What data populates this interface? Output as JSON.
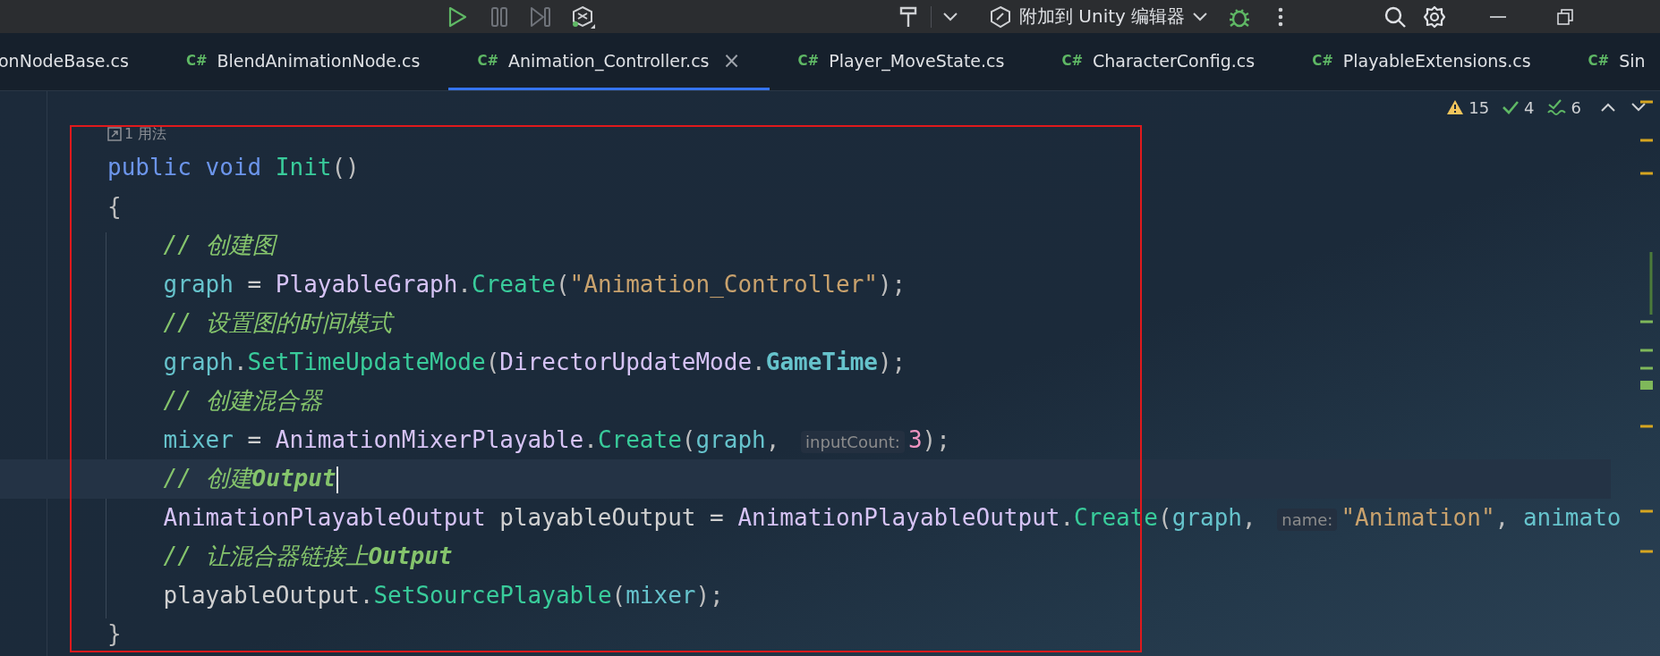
{
  "toolbar": {
    "attach_label": "附加到 Unity 编辑器"
  },
  "tabs": [
    {
      "label": "onNodeBase.cs",
      "selected": false
    },
    {
      "badge": "C#",
      "label": "BlendAnimationNode.cs",
      "selected": false
    },
    {
      "badge": "C#",
      "label": "Animation_Controller.cs",
      "selected": true,
      "close": "×"
    },
    {
      "badge": "C#",
      "label": "Player_MoveState.cs",
      "selected": false
    },
    {
      "badge": "C#",
      "label": "CharacterConfig.cs",
      "selected": false
    },
    {
      "badge": "C#",
      "label": "PlayableExtensions.cs",
      "selected": false
    },
    {
      "badge": "C#",
      "label": "Sin",
      "selected": false
    }
  ],
  "inspections": [
    {
      "kind": "warning",
      "count": "15"
    },
    {
      "kind": "ok",
      "count": "4"
    },
    {
      "kind": "typo",
      "count": "6"
    }
  ],
  "usage_hint": "1 用法",
  "lines": [
    {
      "current": false,
      "segments": [
        {
          "kind": "kw",
          "text": "public void "
        },
        {
          "kind": "method",
          "text": "Init"
        },
        {
          "kind": "punct",
          "text": "()"
        }
      ]
    },
    {
      "current": false,
      "segments": [
        {
          "kind": "punct",
          "text": "{"
        }
      ]
    },
    {
      "current": false,
      "segments": [
        {
          "kind": "comment",
          "text": "    // 创建图"
        }
      ]
    },
    {
      "current": false,
      "segments": [
        {
          "kind": "var",
          "text": "    graph"
        },
        {
          "kind": "plain",
          "text": " = "
        },
        {
          "kind": "type",
          "text": "PlayableGraph"
        },
        {
          "kind": "punct",
          "text": "."
        },
        {
          "kind": "method",
          "text": "Create"
        },
        {
          "kind": "punct",
          "text": "("
        },
        {
          "kind": "str",
          "text": "\"Animation_Controller\""
        },
        {
          "kind": "punct",
          "text": ");"
        }
      ]
    },
    {
      "current": false,
      "segments": [
        {
          "kind": "comment",
          "text": "    // 设置图的时间模式"
        }
      ]
    },
    {
      "current": false,
      "segments": [
        {
          "kind": "var",
          "text": "    graph"
        },
        {
          "kind": "punct",
          "text": "."
        },
        {
          "kind": "method",
          "text": "SetTimeUpdateMode"
        },
        {
          "kind": "punct",
          "text": "("
        },
        {
          "kind": "type",
          "text": "DirectorUpdateMode"
        },
        {
          "kind": "punct",
          "text": "."
        },
        {
          "kind": "enum",
          "text": "GameTime"
        },
        {
          "kind": "punct",
          "text": ");"
        }
      ]
    },
    {
      "current": false,
      "segments": [
        {
          "kind": "comment",
          "text": "    // 创建混合器"
        }
      ]
    },
    {
      "current": false,
      "segments": [
        {
          "kind": "var",
          "text": "    mixer"
        },
        {
          "kind": "plain",
          "text": " = "
        },
        {
          "kind": "type",
          "text": "AnimationMixerPlayable"
        },
        {
          "kind": "punct",
          "text": "."
        },
        {
          "kind": "method",
          "text": "Create"
        },
        {
          "kind": "punct",
          "text": "("
        },
        {
          "kind": "var",
          "text": "graph"
        },
        {
          "kind": "punct",
          "text": ", "
        },
        {
          "kind": "hint",
          "text": "inputCount:"
        },
        {
          "kind": "num",
          "text": "3"
        },
        {
          "kind": "punct",
          "text": ");"
        }
      ]
    },
    {
      "current": true,
      "segments": [
        {
          "kind": "comment",
          "text": "    // 创建**Output**"
        }
      ]
    },
    {
      "current": false,
      "segments": [
        {
          "kind": "type",
          "text": "    AnimationPlayableOutput"
        },
        {
          "kind": "plain",
          "text": " playableOutput = "
        },
        {
          "kind": "type",
          "text": "AnimationPlayableOutput"
        },
        {
          "kind": "punct",
          "text": "."
        },
        {
          "kind": "method",
          "text": "Create"
        },
        {
          "kind": "punct",
          "text": "("
        },
        {
          "kind": "var",
          "text": "graph"
        },
        {
          "kind": "punct",
          "text": ", "
        },
        {
          "kind": "hint",
          "text": "name:"
        },
        {
          "kind": "str",
          "text": "\"Animation\""
        },
        {
          "kind": "punct",
          "text": ", "
        },
        {
          "kind": "var",
          "text": "animato"
        }
      ]
    },
    {
      "current": false,
      "segments": [
        {
          "kind": "comment",
          "text": "    // 让混合器链接上**Output**"
        }
      ]
    },
    {
      "current": false,
      "segments": [
        {
          "kind": "plain",
          "text": "    playableOutput"
        },
        {
          "kind": "punct",
          "text": "."
        },
        {
          "kind": "method",
          "text": "SetSourcePlayable"
        },
        {
          "kind": "punct",
          "text": "("
        },
        {
          "kind": "var",
          "text": "mixer"
        },
        {
          "kind": "punct",
          "text": ");"
        }
      ]
    },
    {
      "current": false,
      "segments": [
        {
          "kind": "punct",
          "text": "}"
        }
      ]
    }
  ]
}
